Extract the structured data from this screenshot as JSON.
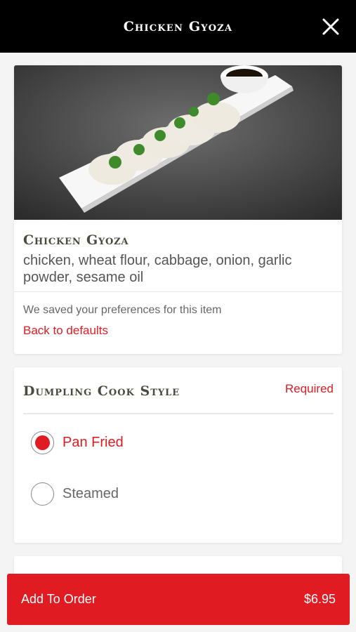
{
  "header": {
    "title": "Chicken Gyoza"
  },
  "item": {
    "name": "Chicken Gyoza",
    "description": "chicken, wheat flour, cabbage, onion, garlic powder, sesame oil",
    "preferences_note": "We saved your preferences for this item",
    "defaults_link": "Back to defaults"
  },
  "options": {
    "title": "Dumpling Cook Style",
    "required_label": "Required",
    "choices": [
      {
        "label": "Pan Fried",
        "selected": true
      },
      {
        "label": "Steamed",
        "selected": false
      }
    ]
  },
  "footer": {
    "add_label": "Add To Order",
    "price": "$6.95"
  },
  "colors": {
    "accent": "#e11b22",
    "header_bg": "#000000"
  }
}
